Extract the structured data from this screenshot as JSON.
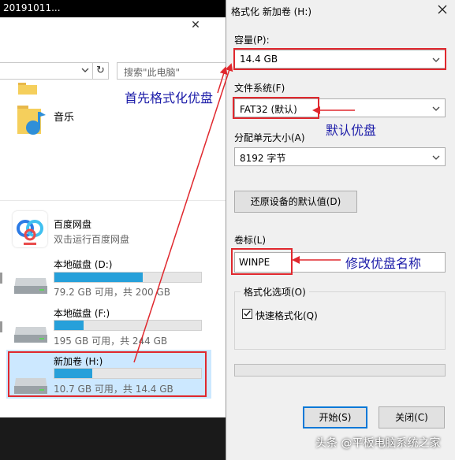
{
  "explorer": {
    "title_fragment": "20191011...",
    "search_placeholder": "搜索\"此电脑\"",
    "music_label": "音乐",
    "baidu": {
      "name": "百度网盘",
      "desc": "双击运行百度网盘"
    },
    "drives": [
      {
        "name": "本地磁盘 (D:)",
        "space": "79.2 GB 可用，共 200 GB",
        "used_fraction": 0.6
      },
      {
        "name": "本地磁盘 (F:)",
        "space": "195 GB 可用，共 244 GB",
        "used_fraction": 0.2
      },
      {
        "name": "新加卷 (H:)",
        "space": "10.7 GB 可用，共 14.4 GB",
        "used_fraction": 0.26
      }
    ]
  },
  "dialog": {
    "title": "格式化 新加卷 (H:)",
    "capacity_label": "容量(P):",
    "capacity_value": "14.4 GB",
    "filesystem_label": "文件系统(F)",
    "filesystem_value": "FAT32 (默认)",
    "unit_label": "分配单元大小(A)",
    "unit_value": "8192 字节",
    "restore_button": "还原设备的默认值(D)",
    "volume_label": "卷标(L)",
    "volume_value": "WINPE",
    "options_label": "格式化选项(O)",
    "quick_format_label": "快速格式化(Q)",
    "quick_format_checked": true,
    "start_button": "开始(S)",
    "close_button": "关闭(C)"
  },
  "annotations": {
    "format_first": "首先格式化优盘",
    "default_disk": "默认优盘",
    "rename_disk": "修改优盘名称"
  },
  "watermark": "头条 @平板电脑系统之家",
  "colors": {
    "accent_red": "#e0282e",
    "annotation_blue": "#1a1aa8",
    "drive_bar": "#26a0da",
    "selection": "#cce8ff"
  }
}
